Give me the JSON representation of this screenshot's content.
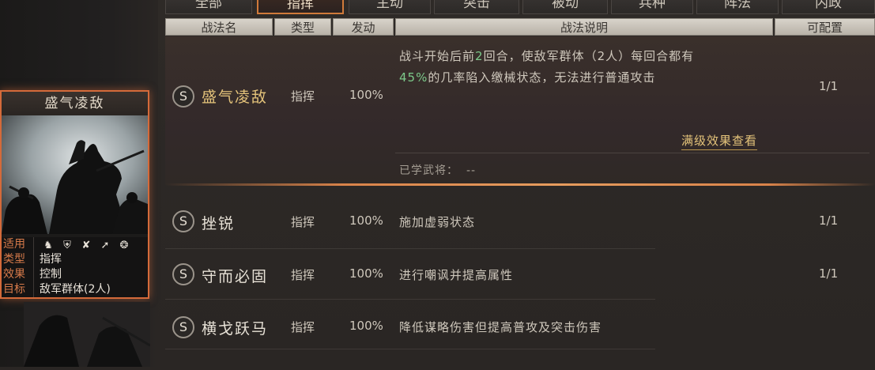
{
  "tabs": [
    {
      "label": "全部"
    },
    {
      "label": "指挥",
      "active": true
    },
    {
      "label": "主动"
    },
    {
      "label": "突击"
    },
    {
      "label": "被动"
    },
    {
      "label": "兵种"
    },
    {
      "label": "阵法"
    },
    {
      "label": "内政"
    }
  ],
  "headers": {
    "name": "战法名",
    "type": "类型",
    "trigger": "发动",
    "desc": "战法说明",
    "config": "可配置"
  },
  "rows": [
    {
      "badge": "S",
      "name": "盛气凌敌",
      "type": "指挥",
      "trigger": "100%",
      "desc_line1_a": "战斗开始后前",
      "desc_line1_num": "2",
      "desc_line1_b": "回合，使敌军群体（2人）每回合都有",
      "desc_line2_pct": "45%",
      "desc_line2_b": "的几率陷入缴械状态，无法进行普通攻击",
      "config": "1/1",
      "link": "满级效果查看",
      "learned_label": "已学武将：",
      "learned_value": "--"
    },
    {
      "badge": "S",
      "name": "挫锐",
      "type": "指挥",
      "trigger": "100%",
      "desc": "施加虚弱状态",
      "config": "1/1"
    },
    {
      "badge": "S",
      "name": "守而必固",
      "type": "指挥",
      "trigger": "100%",
      "desc": "进行嘲讽并提高属性",
      "config": "1/1"
    },
    {
      "badge": "S",
      "name": "横戈跃马",
      "type": "指挥",
      "trigger": "100%",
      "desc": "降低谋略伤害但提高普攻及突击伤害",
      "config": ""
    }
  ],
  "card": {
    "title": "盛气凌敌",
    "fit_label": "适用",
    "fit_icons": [
      "cavalry-icon",
      "shield-icon",
      "bow-icon",
      "spear-icon",
      "wheel-icon"
    ],
    "type_label": "类型",
    "type_value": "指挥",
    "effect_label": "效果",
    "effect_value": "控制",
    "target_label": "目标",
    "target_value": "敌军群体(2人)"
  },
  "colors": {
    "accent": "#d46a3a",
    "gold": "#e4c37a",
    "highlight_green": "#7cc98a"
  }
}
